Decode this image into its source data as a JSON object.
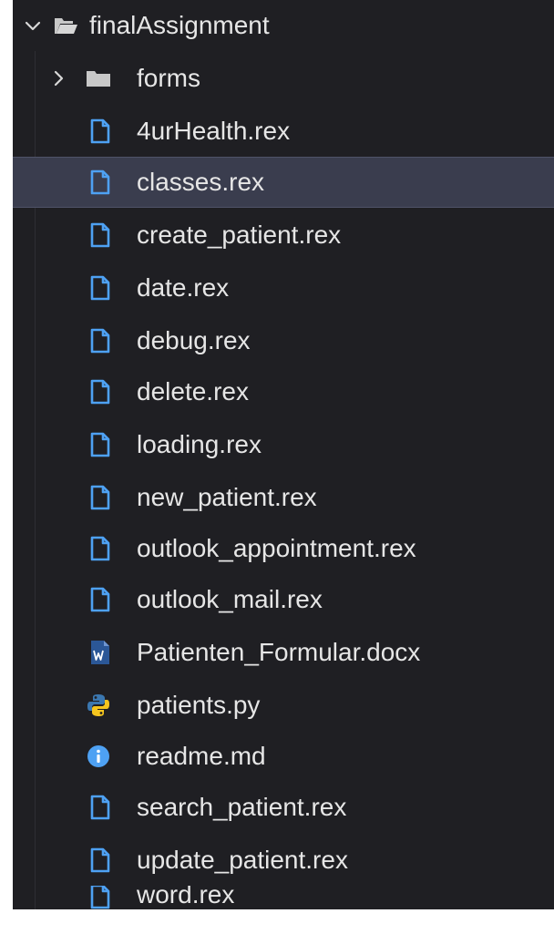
{
  "root": {
    "label": "finalAssignment",
    "icon": "folder-open-icon",
    "expanded": true
  },
  "folders": [
    {
      "label": "forms",
      "icon": "folder-icon",
      "expanded": false
    }
  ],
  "files": [
    {
      "label": "4urHealth.rex",
      "icon": "file-icon"
    },
    {
      "label": "classes.rex",
      "icon": "file-icon",
      "selected": true
    },
    {
      "label": "create_patient.rex",
      "icon": "file-icon"
    },
    {
      "label": "date.rex",
      "icon": "file-icon"
    },
    {
      "label": "debug.rex",
      "icon": "file-icon"
    },
    {
      "label": "delete.rex",
      "icon": "file-icon"
    },
    {
      "label": "loading.rex",
      "icon": "file-icon"
    },
    {
      "label": "new_patient.rex",
      "icon": "file-icon"
    },
    {
      "label": "outlook_appointment.rex",
      "icon": "file-icon"
    },
    {
      "label": "outlook_mail.rex",
      "icon": "file-icon"
    },
    {
      "label": "Patienten_Formular.docx",
      "icon": "word-doc-icon"
    },
    {
      "label": "patients.py",
      "icon": "python-icon"
    },
    {
      "label": "readme.md",
      "icon": "info-icon"
    },
    {
      "label": "search_patient.rex",
      "icon": "file-icon"
    },
    {
      "label": "update_patient.rex",
      "icon": "file-icon"
    },
    {
      "label": "word.rex",
      "icon": "file-icon"
    }
  ],
  "colors": {
    "background": "#1f1f23",
    "selected_row": "#3a3d4e",
    "file_icon": "#4ea1f3",
    "text": "#e6e6e6",
    "python_blue": "#3b77b0",
    "python_yellow": "#f5c51e",
    "word_blue": "#2b5797"
  }
}
